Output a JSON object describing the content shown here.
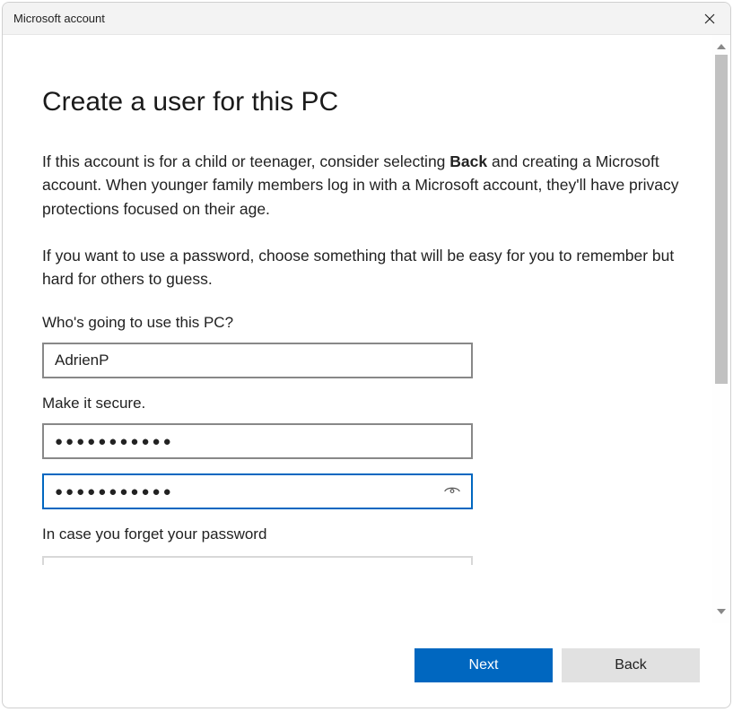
{
  "window": {
    "title": "Microsoft account"
  },
  "page": {
    "heading": "Create a user for this PC",
    "intro_pre": "If this account is for a child or teenager, consider selecting ",
    "intro_bold": "Back",
    "intro_post": " and creating a Microsoft account. When younger family members log in with a Microsoft account, they'll have privacy protections focused on their age.",
    "password_hint": "If you want to use a password, choose something that will be easy for you to remember but hard for others to guess.",
    "q_username_label": "Who's going to use this PC?",
    "q_password_label": "Make it secure.",
    "q_recovery_label": "In case you forget your password"
  },
  "form": {
    "username": "AdrienP",
    "password_mask": "●●●●●●●●●●●",
    "password_confirm_mask": "●●●●●●●●●●●"
  },
  "footer": {
    "next_label": "Next",
    "back_label": "Back"
  }
}
